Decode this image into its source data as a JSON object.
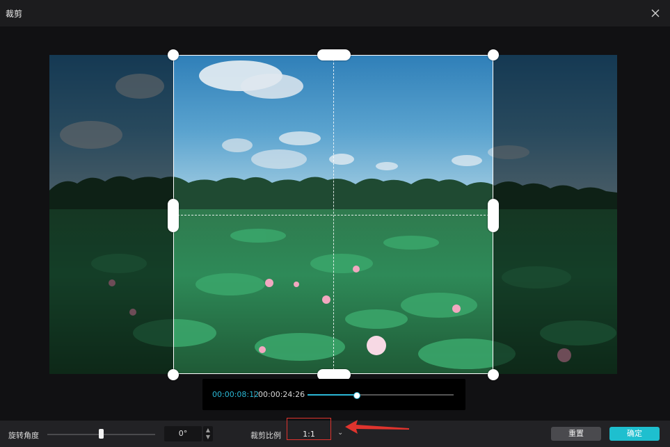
{
  "window": {
    "title": "裁剪"
  },
  "icons": {
    "close": "close-icon",
    "caret": "chevron-down-icon"
  },
  "playback": {
    "current_time": "00:00:08:12",
    "separator": "|",
    "total_time": "00:00:24:26",
    "progress": 0.34
  },
  "toolbar": {
    "rotation_label": "旋转角度",
    "rotation_value": "0°",
    "rotation_slider_level": 0.5,
    "ratio_label": "裁剪比例",
    "ratio_value": "1:1",
    "reset_label": "重置",
    "confirm_label": "确定"
  },
  "colors": {
    "accent": "#1ebfcf",
    "time_highlight": "#2bb8d6",
    "annotation_red": "#e0342e"
  }
}
